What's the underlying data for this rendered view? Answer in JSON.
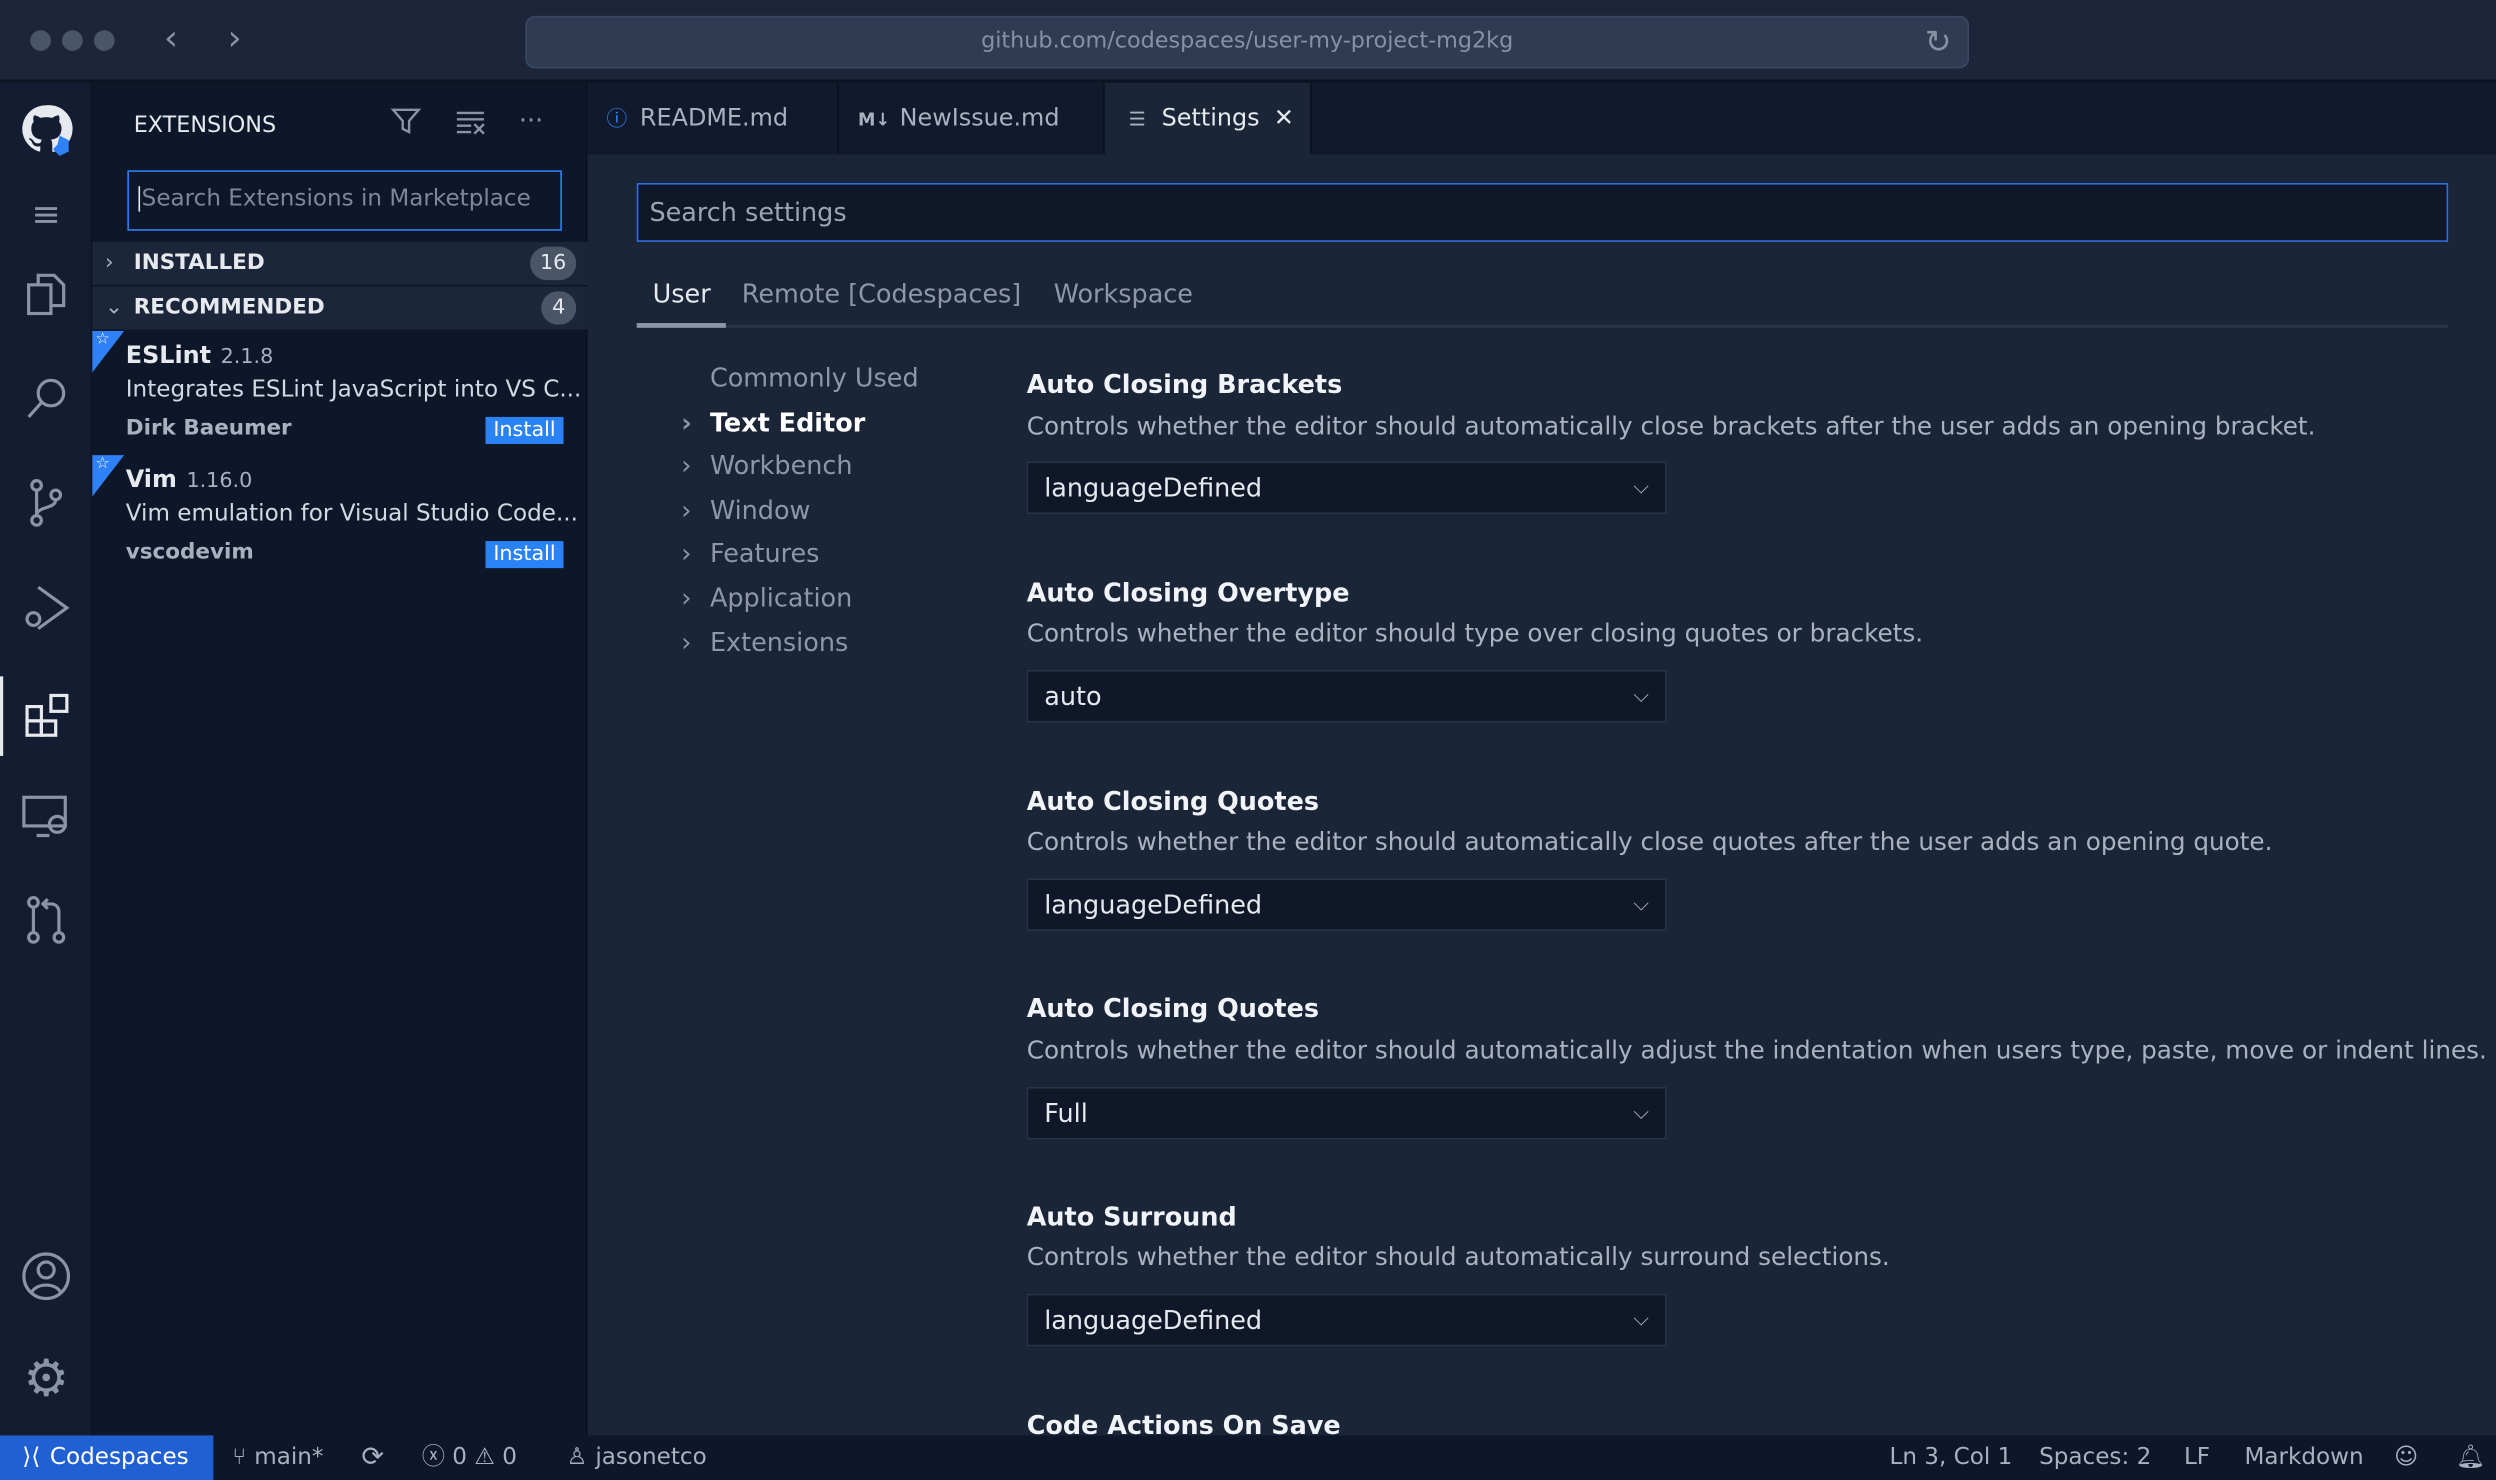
{
  "browser": {
    "url": "github.com/codespaces/user-my-project-mg2kg"
  },
  "sidebar": {
    "title": "EXTENSIONS",
    "search_placeholder": "Search Extensions in Marketplace",
    "sections": [
      {
        "label": "INSTALLED",
        "count": "16",
        "expanded": false
      },
      {
        "label": "RECOMMENDED",
        "count": "4",
        "expanded": true
      }
    ],
    "extensions": [
      {
        "name": "ESLint",
        "version": "2.1.8",
        "description": "Integrates ESLint JavaScript into VS C...",
        "author": "Dirk Baeumer",
        "action": "Install"
      },
      {
        "name": "Vim",
        "version": "1.16.0",
        "description": "Vim emulation for Visual Studio Code...",
        "author": "vscodevim",
        "action": "Install"
      }
    ]
  },
  "tabs": [
    {
      "label": "README.md",
      "icon": "info-icon"
    },
    {
      "label": "NewIssue.md",
      "icon": "markdown-icon",
      "prefix": "M↓"
    },
    {
      "label": "Settings",
      "icon": "settings-list-icon",
      "active": true
    }
  ],
  "settings": {
    "search_placeholder": "Search settings",
    "scopes": [
      "User",
      "Remote [Codespaces]",
      "Workspace"
    ],
    "toc": [
      "Commonly Used",
      "Text Editor",
      "Workbench",
      "Window",
      "Features",
      "Application",
      "Extensions"
    ],
    "items": [
      {
        "title": "Auto Closing Brackets",
        "description": "Controls whether the editor should automatically close brackets after the user adds an opening bracket.",
        "value": "languageDefined"
      },
      {
        "title": "Auto Closing Overtype",
        "description": "Controls whether the editor should type over closing quotes or brackets.",
        "value": "auto"
      },
      {
        "title": "Auto Closing Quotes",
        "description": "Controls whether the editor should automatically close quotes after the user adds an opening quote.",
        "value": "languageDefined"
      },
      {
        "title": "Auto Closing Quotes",
        "description": "Controls whether the editor should automatically adjust the indentation when users type, paste, move or indent lines.",
        "value": "Full"
      },
      {
        "title": "Auto Surround",
        "description": "Controls whether the editor should automatically surround selections.",
        "value": "languageDefined"
      },
      {
        "title": "Code Actions On Save"
      }
    ]
  },
  "status": {
    "remote": "Codespaces",
    "branch": "main*",
    "errors": "0",
    "warnings": "0",
    "user": "jasonetco",
    "position": "Ln 3, Col 1",
    "spaces": "Spaces: 2",
    "eol": "LF",
    "language": "Markdown"
  },
  "colors": {
    "accent": "#2f81f7",
    "status_remote": "#2160d3",
    "install": "#2a83f6"
  }
}
